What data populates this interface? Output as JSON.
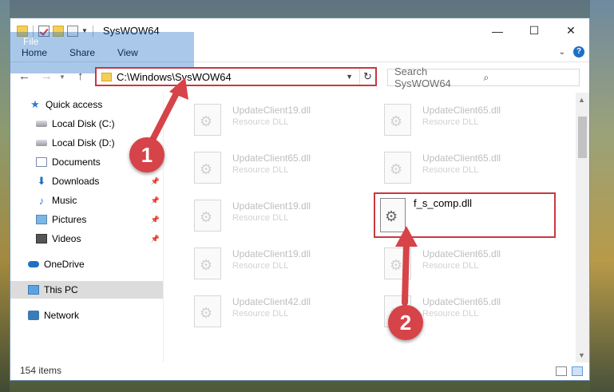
{
  "window": {
    "title": "SysWOW64",
    "controls": {
      "minimize": "—",
      "maximize": "☐",
      "close": "✕"
    }
  },
  "ribbon": {
    "tabs": [
      "File",
      "Home",
      "Share",
      "View"
    ],
    "help": "?"
  },
  "address": {
    "path": "C:\\Windows\\SysWOW64",
    "search_placeholder": "Search SysWOW64"
  },
  "nav": {
    "items": [
      {
        "label": "Quick access",
        "icon": "star-icon",
        "pinned": false
      },
      {
        "label": "Local Disk (C:)",
        "icon": "drive-icon",
        "pinned": false
      },
      {
        "label": "Local Disk (D:)",
        "icon": "drive-icon",
        "pinned": false
      },
      {
        "label": "Documents",
        "icon": "document-icon",
        "pinned": true
      },
      {
        "label": "Downloads",
        "icon": "download-icon",
        "pinned": true
      },
      {
        "label": "Music",
        "icon": "music-icon",
        "pinned": true
      },
      {
        "label": "Pictures",
        "icon": "pictures-icon",
        "pinned": true
      },
      {
        "label": "Videos",
        "icon": "videos-icon",
        "pinned": true
      },
      {
        "label": "OneDrive",
        "icon": "cloud-icon",
        "pinned": false
      },
      {
        "label": "This PC",
        "icon": "pc-icon",
        "pinned": false,
        "selected": true
      },
      {
        "label": "Network",
        "icon": "network-icon",
        "pinned": false
      }
    ]
  },
  "files": [
    {
      "name": "UpdateClient19.dll",
      "type": "Resource DLL"
    },
    {
      "name": "UpdateClient65.dll",
      "type": "Resource DLL"
    },
    {
      "name": "UpdateClient65.dll",
      "type": "Resource DLL"
    },
    {
      "name": "UpdateClient65.dll",
      "type": "Resource DLL"
    },
    {
      "name": "UpdateClient19.dll",
      "type": "Resource DLL"
    },
    {
      "name": "UpdateClient19.dll",
      "type": "Resource DLL"
    },
    {
      "name": "UpdateClient65.dll",
      "type": "Resource DLL"
    },
    {
      "name": "UpdateClient42.dll",
      "type": "Resource DLL"
    },
    {
      "name": "UpdateClient65.dll",
      "type": "Resource DLL"
    }
  ],
  "highlighted_file": {
    "name": "f_s_comp.dll"
  },
  "status": {
    "items_count": "154 items"
  },
  "annotations": {
    "step1": "1",
    "step2": "2"
  },
  "colors": {
    "accent": "#1f6fc5",
    "highlight": "#c9383f"
  }
}
